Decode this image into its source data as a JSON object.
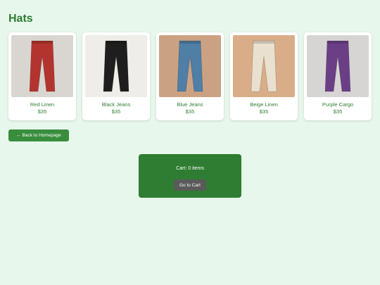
{
  "page": {
    "title": "Hats"
  },
  "products": [
    {
      "name": "Red Linen",
      "price": "$35",
      "image": "pants-icon",
      "bg_color": "#d9d6d2",
      "pants_color": "#b3342e"
    },
    {
      "name": "Black Jeans",
      "price": "$35",
      "image": "pants-icon",
      "bg_color": "#efede9",
      "pants_color": "#1e1e1e"
    },
    {
      "name": "Blue Jeans",
      "price": "$35",
      "image": "pants-icon",
      "bg_color": "#caa283",
      "pants_color": "#4f7ea6"
    },
    {
      "name": "Beige Linen",
      "price": "$35",
      "image": "pants-icon",
      "bg_color": "#d8ad88",
      "pants_color": "#e9e0cf"
    },
    {
      "name": "Purple Cargo",
      "price": "$35",
      "image": "pants-icon",
      "bg_color": "#d7d5d3",
      "pants_color": "#6b3f86"
    }
  ],
  "nav": {
    "back_label": "← Back to Homepage"
  },
  "cart": {
    "status": "Cart: 0 items",
    "button_label": "Go to Cart"
  },
  "colors": {
    "accent": "#2e7d32",
    "background": "#e8f7ec",
    "button_dark": "#5a5a5a"
  }
}
